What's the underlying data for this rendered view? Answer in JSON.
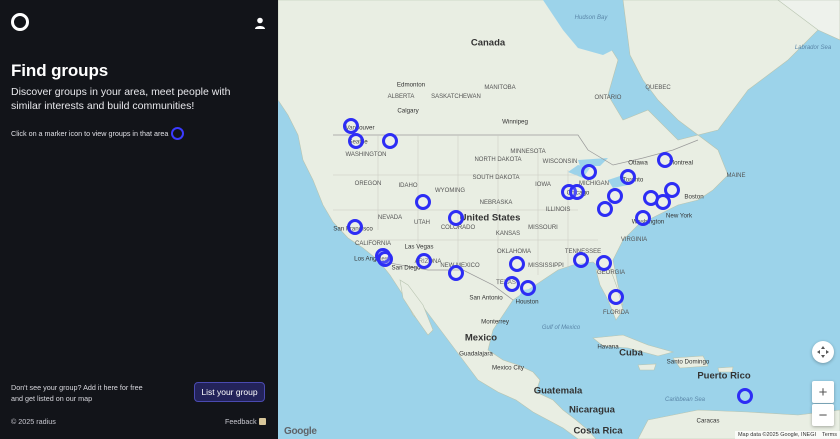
{
  "sidebar": {
    "title": "Find groups",
    "subtitle": "Discover groups in your area, meet people with similar interests and build communities!",
    "hint": "Click on a marker icon to view groups in that area",
    "cta_text": "Don't see your group? Add it here for free and get listed on our map",
    "cta_button": "List your group",
    "copyright": "© 2025 radius",
    "feedback": "Feedback"
  },
  "map": {
    "labels": {
      "hudson_bay": "Hudson Bay",
      "labrador_sea": "Labrador Sea",
      "canada": "Canada",
      "edmonton": "Edmonton",
      "alberta": "ALBERTA",
      "calgary": "Calgary",
      "manitoba": "MANITOBA",
      "saskatchewan": "SASKATCHEWAN",
      "winnipeg": "Winnipeg",
      "quebec": "QUEBEC",
      "ontario": "ONTARIO",
      "vancouver": "Vancouver",
      "seattle": "Seattle",
      "washington": "WASHINGTON",
      "oregon": "OREGON",
      "idaho": "IDAHO",
      "wyoming": "WYOMING",
      "south_dakota": "SOUTH DAKOTA",
      "north_dakota": "NORTH DAKOTA",
      "nebraska": "NEBRASKA",
      "nevada": "NEVADA",
      "utah": "UTAH",
      "colorado": "COLORADO",
      "united_states": "United States",
      "san_francisco": "San Francisco",
      "california": "CALIFORNIA",
      "las_vegas": "Las Vegas",
      "los_angeles": "Los Angeles",
      "san_diego": "San Diego",
      "arizona": "ARIZONA",
      "new_mexico": "NEW MEXICO",
      "kansas": "KANSAS",
      "oklahoma": "OKLAHOMA",
      "texas": "TEXAS",
      "san_antonio": "San Antonio",
      "houston": "Houston",
      "missouri": "MISSOURI",
      "illinois": "ILLINOIS",
      "iowa": "IOWA",
      "minnesota": "MINNESOTA",
      "wisconsin": "WISCONSIN",
      "michigan": "MICHIGAN",
      "chicago": "Chicago",
      "toronto": "Toronto",
      "ottawa": "Ottawa",
      "montreal": "Montreal",
      "boston": "Boston",
      "new_york": "New York",
      "washington_dc": "Washington",
      "virginia": "VIRGINIA",
      "tennessee": "TENNESSEE",
      "mississippi": "MISSISSIPPI",
      "georgia": "GEORGIA",
      "florida": "FLORIDA",
      "maine": "MAINE",
      "gulf": "Gulf of Mexico",
      "mexico": "Mexico",
      "monterrey": "Monterrey",
      "guadalajara": "Guadalajara",
      "mexico_city": "Mexico City",
      "havana": "Havana",
      "cuba": "Cuba",
      "santo_domingo": "Santo Domingo",
      "puerto_rico": "Puerto Rico",
      "guatemala": "Guatemala",
      "nicaragua": "Nicaragua",
      "costa_rica": "Costa Rica",
      "caribbean": "Caribbean Sea",
      "caracas": "Caracas"
    },
    "zoom_in": "+",
    "zoom_out": "−",
    "google": "Google",
    "attribution": "Map data ©2025 Google, INEGI",
    "terms": "Terms",
    "colors": {
      "marker": "#2d2df5",
      "water": "#9cd3ea",
      "land": "#e9eee3"
    }
  }
}
